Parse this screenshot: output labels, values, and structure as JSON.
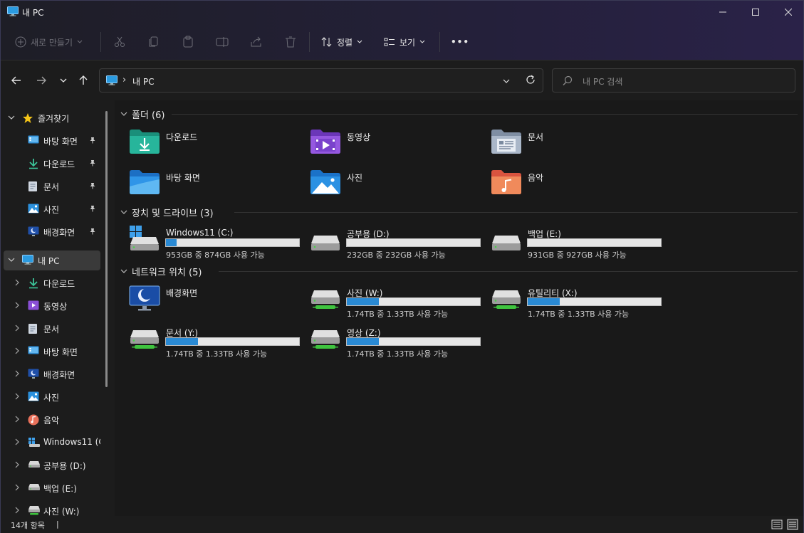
{
  "window": {
    "title": "내 PC"
  },
  "toolbar": {
    "new_label": "새로 만들기",
    "sort_label": "정렬",
    "view_label": "보기",
    "more_label": "•••"
  },
  "address": {
    "crumb": "내 PC",
    "separator": "›"
  },
  "search": {
    "placeholder": "내 PC 검색"
  },
  "sidebar": {
    "quick_access": "즐겨찾기",
    "pinned": [
      {
        "label": "바탕 화면",
        "icon": "desktop-icon"
      },
      {
        "label": "다운로드",
        "icon": "download-icon"
      },
      {
        "label": "문서",
        "icon": "document-icon"
      },
      {
        "label": "사진",
        "icon": "pictures-icon"
      },
      {
        "label": "배경화면",
        "icon": "wallpaper-icon"
      }
    ],
    "this_pc": "내 PC",
    "pc_items": [
      {
        "label": "다운로드",
        "icon": "download-icon"
      },
      {
        "label": "동영상",
        "icon": "video-icon"
      },
      {
        "label": "문서",
        "icon": "document-icon"
      },
      {
        "label": "바탕 화면",
        "icon": "desktop-icon"
      },
      {
        "label": "배경화면",
        "icon": "wallpaper-icon"
      },
      {
        "label": "사진",
        "icon": "pictures-icon"
      },
      {
        "label": "음악",
        "icon": "music-icon"
      },
      {
        "label": "Windows11 (C",
        "icon": "windows-drive-icon"
      },
      {
        "label": "공부용 (D:)",
        "icon": "drive-icon"
      },
      {
        "label": "백업 (E:)",
        "icon": "drive-icon"
      },
      {
        "label": "사진 (W:)",
        "icon": "network-drive-icon"
      }
    ]
  },
  "groups": {
    "folders": "폴더 (6)",
    "drives": "장치 및 드라이브 (3)",
    "network": "네트워크 위치 (5)"
  },
  "folders": [
    {
      "name": "다운로드",
      "icon": "download-folder-icon"
    },
    {
      "name": "동영상",
      "icon": "video-folder-icon"
    },
    {
      "name": "문서",
      "icon": "document-folder-icon"
    },
    {
      "name": "바탕 화면",
      "icon": "desktop-folder-icon"
    },
    {
      "name": "사진",
      "icon": "pictures-folder-icon"
    },
    {
      "name": "음악",
      "icon": "music-folder-icon"
    }
  ],
  "drives": [
    {
      "name": "Windows11 (C:)",
      "free": "953GB 중 874GB 사용 가능",
      "used_fraction": 0.08,
      "icon": "windows-drive-icon"
    },
    {
      "name": "공부용 (D:)",
      "free": "232GB 중 232GB 사용 가능",
      "used_fraction": 0.0,
      "icon": "drive-icon"
    },
    {
      "name": "백업 (E:)",
      "free": "931GB 중 927GB 사용 가능",
      "used_fraction": 0.0,
      "icon": "drive-icon"
    }
  ],
  "network": [
    {
      "name": "배경화면",
      "icon": "network-folder-monitor-icon"
    },
    {
      "name": "사진 (W:)",
      "free": "1.74TB 중 1.33TB 사용 가능",
      "used_fraction": 0.24,
      "icon": "network-drive-icon"
    },
    {
      "name": "유틸리티 (X:)",
      "free": "1.74TB 중 1.33TB 사용 가능",
      "used_fraction": 0.24,
      "icon": "network-drive-icon"
    },
    {
      "name": "문서 (Y:)",
      "free": "1.74TB 중 1.33TB 사용 가능",
      "used_fraction": 0.24,
      "icon": "network-drive-icon"
    },
    {
      "name": "영상 (Z:)",
      "free": "1.74TB 중 1.33TB 사용 가능",
      "used_fraction": 0.24,
      "icon": "network-drive-icon"
    }
  ],
  "status": {
    "count": "14개 항목",
    "caret": "|"
  },
  "colors": {
    "accent": "#2a8ad4",
    "bg": "#191919",
    "title_gradient_end": "#2a2248"
  }
}
